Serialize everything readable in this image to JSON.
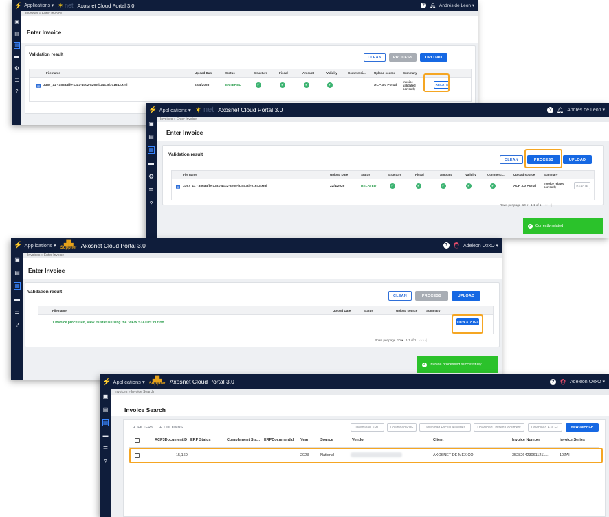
{
  "colors": {
    "nav": "#0f1d3b",
    "accent": "#1668e3",
    "success": "#2bc22b",
    "highlight": "#f5a623"
  },
  "s1": {
    "apps": "Applications ▾",
    "logo": "net",
    "title": "Axosnet Cloud Portal 3.0",
    "user": "Andrés de Leon ▾",
    "crumb": "Invoices  »  Enter Invoice",
    "page_title": "Enter Invoice",
    "section": "Validation result",
    "buttons": {
      "clean": "CLEAN",
      "process": "PROCESS",
      "upload": "UPLOAD"
    },
    "headers": [
      "File name",
      "Upload Date",
      "Status",
      "Structure",
      "Fiscal",
      "Amount",
      "Validity",
      "Commerci...",
      "Upload source",
      "Summary"
    ],
    "row": {
      "file": "3367_11 - a56aaffe-13a1-4cc2-8265-b24c3d701643.xml",
      "date": "22/4/2026",
      "status": "ENTERED",
      "source": "ACP 3.0 Portal",
      "summary": "Invoice validated correctly",
      "action": "RELATE"
    },
    "pager": {
      "label": "Rows per page",
      "size": "10",
      "range": "1-1 of 1"
    }
  },
  "s2": {
    "apps": "Applications ▾",
    "logo": "net",
    "title": "Axosnet Cloud Portal 3.0",
    "user": "Andrés de Leon ▾",
    "crumb": "Invoices  »  Enter Invoice",
    "page_title": "Enter Invoice",
    "section": "Validation result",
    "buttons": {
      "clean": "CLEAN",
      "process": "PROCESS",
      "upload": "UPLOAD"
    },
    "headers": [
      "File name",
      "Upload Date",
      "Status",
      "Structure",
      "Fiscal",
      "Amount",
      "Validity",
      "Commerci...",
      "Upload source",
      "Summary"
    ],
    "row": {
      "file": "3367_11 - a56aaffe-13a1-4cc2-8265-b24c3d701643.xml",
      "date": "22/4/2026",
      "status": "RELATED",
      "source": "ACP 3.0 Portal",
      "summary": "Invoice related correctly",
      "action": "RELATE"
    },
    "pager": {
      "label": "Rows per page",
      "size": "10",
      "range": "1-1 of 1"
    },
    "toast": "Correctly related"
  },
  "s3": {
    "apps": "Applications ▾",
    "logo": "Supplier",
    "title": "Axosnet Cloud Portal 3.0",
    "user": "Adeleon OxxO ▾",
    "crumb": "Invoices  »  Enter Invoice",
    "page_title": "Enter Invoice",
    "section": "Validation result",
    "buttons": {
      "clean": "CLEAN",
      "process": "PROCESS",
      "upload": "UPLOAD"
    },
    "headers": [
      "File name",
      "Upload Date",
      "Status",
      "Upload source",
      "Summary"
    ],
    "message": "1 Invoice processed, view its status using the 'VIEW STATUS' button",
    "view_status": "VIEW STATUS",
    "pager": {
      "label": "Rows per page",
      "size": "10",
      "range": "1-1 of 1"
    },
    "toast": "Invoice processed successfully"
  },
  "s4": {
    "apps": "Applications ▾",
    "logo": "Supplier",
    "title": "Axosnet Cloud Portal 3.0",
    "user": "Adeleon OxxO ▾",
    "crumb": "Invoices  »  Invoice Search",
    "page_title": "Invoice Search",
    "filters": "FILTERS",
    "columns": "COLUMNS",
    "actions": [
      "Download XML",
      "Download PDF",
      "Download Excel Deliveries",
      "Download Unified Document",
      "Download EXCEL",
      "NEW SEARCH"
    ],
    "headers": [
      "ACP3DocumentID",
      "ERP Status",
      "Complement Sta...",
      "ERPDocumentId",
      "Year",
      "Source",
      "Vendor",
      "Client",
      "Invoice Number",
      "Invoice Series"
    ],
    "row": {
      "id": "15,160",
      "year": "2023",
      "source": "National",
      "client": "AXOSNET DE MEXICO",
      "number": "3528264230611211...",
      "series": "10ZAI"
    }
  }
}
